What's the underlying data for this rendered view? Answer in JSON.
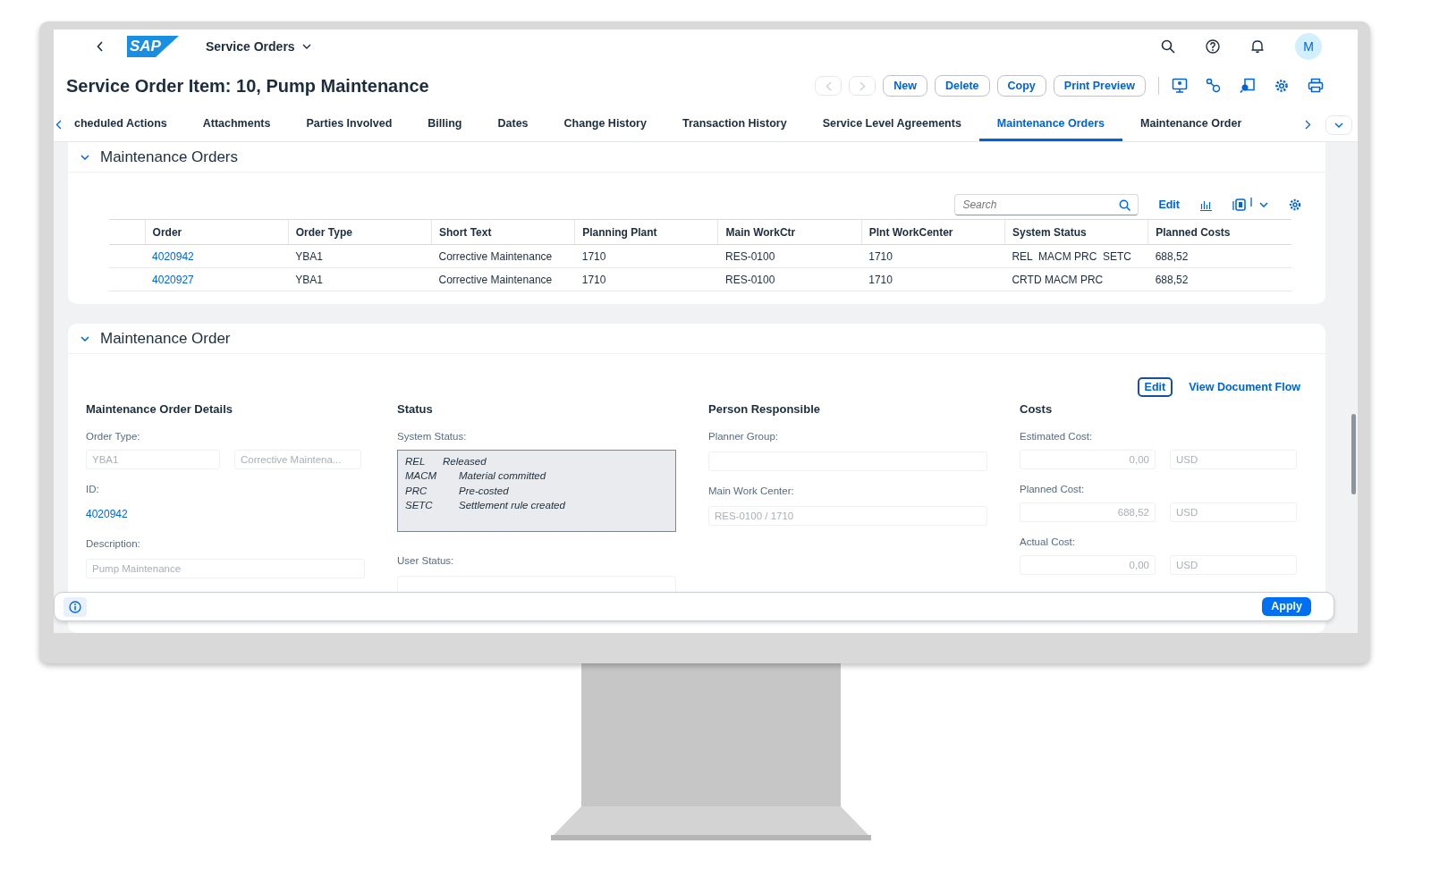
{
  "shell": {
    "logo": "SAP",
    "app_title": "Service Orders",
    "avatar": "M"
  },
  "page_title": "Service Order Item: 10, Pump Maintenance",
  "actions": [
    "New",
    "Delete",
    "Copy",
    "Print Preview"
  ],
  "tabs": [
    {
      "label": "cheduled Actions",
      "selected": false
    },
    {
      "label": "Attachments",
      "selected": false
    },
    {
      "label": "Parties Involved",
      "selected": false
    },
    {
      "label": "Billing",
      "selected": false
    },
    {
      "label": "Dates",
      "selected": false
    },
    {
      "label": "Change History",
      "selected": false
    },
    {
      "label": "Transaction History",
      "selected": false
    },
    {
      "label": "Service Level Agreements",
      "selected": false
    },
    {
      "label": "Maintenance Orders",
      "selected": true
    },
    {
      "label": "Maintenance Order",
      "selected": false
    }
  ],
  "orders_section": {
    "title": "Maintenance Orders",
    "search": {
      "placeholder": "Search"
    },
    "edit": "Edit",
    "table": {
      "columns": [
        "Order",
        "Order Type",
        "Short Text",
        "Planning Plant",
        "Main WorkCtr",
        "Plnt WorkCenter",
        "System Status",
        "Planned Costs"
      ],
      "rows": [
        [
          "4020942",
          "YBA1",
          "Corrective Maintenance",
          "1710",
          "RES-0100",
          "1710",
          "REL  MACM PRC  SETC",
          "688,52"
        ],
        [
          "4020927",
          "YBA1",
          "Corrective Maintenance",
          "1710",
          "RES-0100",
          "1710",
          "CRTD MACM PRC",
          "688,52"
        ]
      ]
    }
  },
  "order_section": {
    "title": "Maintenance Order",
    "edit": "Edit",
    "document_flow": "View Document Flow",
    "details": {
      "heading": "Maintenance Order Details",
      "order_type_label": "Order Type:",
      "order_type": "YBA1",
      "order_type_text": "Corrective Maintena...",
      "id_label": "ID:",
      "id": "4020942",
      "description_label": "Description:",
      "description": "Pump Maintenance"
    },
    "status": {
      "heading": "Status",
      "system_status_label": "System Status:",
      "system_status": [
        {
          "code": "REL",
          "text": "Released"
        },
        {
          "code": "MACM",
          "text": "Material committed"
        },
        {
          "code": "PRC",
          "text": "Pre-costed"
        },
        {
          "code": "SETC",
          "text": "Settlement rule created"
        }
      ],
      "user_status_label": "User Status:"
    },
    "person": {
      "heading": "Person Responsible",
      "planner_group_label": "Planner Group:",
      "main_work_center_label": "Main Work Center:",
      "main_work_center": "RES-0100 / 1710"
    },
    "costs": {
      "heading": "Costs",
      "rows": [
        {
          "label": "Estimated Cost:",
          "amount": "0,00",
          "currency": "USD"
        },
        {
          "label": "Planned Cost:",
          "amount": "688,52",
          "currency": "USD"
        },
        {
          "label": "Actual Cost:",
          "amount": "0,00",
          "currency": "USD"
        }
      ]
    }
  },
  "footer": {
    "apply": "Apply"
  }
}
